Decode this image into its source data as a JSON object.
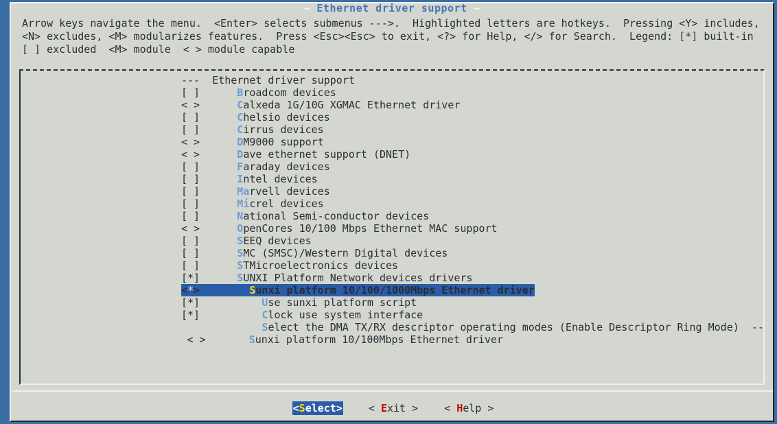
{
  "window": {
    "background_color": "#3b6ea5",
    "panel_color": "#d4d7d0",
    "title": "Ethernet driver support",
    "title_color": "#4876b8",
    "selection_bg": "#2b5ca8",
    "selection_fg": "#ffffff",
    "hotkey_color": "#6c9bd2",
    "hotkey_selected_color": "#ffe000",
    "button_hotkey_color": "#c00000",
    "title_dash_left": "—",
    "title_dash_right": "—"
  },
  "legend": {
    "text": "Arrow keys navigate the menu.  <Enter> selects submenus --->.  Highlighted letters are hotkeys.  Pressing <Y> includes,\n<N> excludes, <M> modularizes features.  Press <Esc><Esc> to exit, <?> for Help, </> for Search.  Legend: [*] built-in\n[ ] excluded  <M> module  < > module capable"
  },
  "menu": {
    "header": {
      "prefix": "---",
      "title": "Ethernet driver support"
    },
    "items": [
      {
        "marker": "[ ]",
        "hotkey": "B",
        "label": "roadcom devices",
        "indent": 0,
        "sub": 0,
        "selected": false,
        "submenu": false
      },
      {
        "marker": "< >",
        "hotkey": "C",
        "label": "alxeda 1G/10G XGMAC Ethernet driver",
        "indent": 0,
        "sub": 0,
        "selected": false,
        "submenu": false
      },
      {
        "marker": "[ ]",
        "hotkey": "C",
        "label": "helsio devices",
        "indent": 0,
        "sub": 0,
        "selected": false,
        "submenu": false
      },
      {
        "marker": "[ ]",
        "hotkey": "C",
        "label": "irrus devices",
        "indent": 0,
        "sub": 0,
        "selected": false,
        "submenu": false
      },
      {
        "marker": "< >",
        "hotkey": "D",
        "label": "M9000 support",
        "indent": 0,
        "sub": 0,
        "selected": false,
        "submenu": false
      },
      {
        "marker": "< >",
        "hotkey": "D",
        "label": "ave ethernet support (DNET)",
        "indent": 0,
        "sub": 0,
        "selected": false,
        "submenu": false
      },
      {
        "marker": "[ ]",
        "hotkey": "F",
        "label": "araday devices",
        "indent": 0,
        "sub": 0,
        "selected": false,
        "submenu": false
      },
      {
        "marker": "[ ]",
        "hotkey": "I",
        "label": "ntel devices",
        "indent": 0,
        "sub": 0,
        "selected": false,
        "submenu": false
      },
      {
        "marker": "[ ]",
        "hotkey": "Ma",
        "label": "rvell devices",
        "indent": 0,
        "sub": 0,
        "selected": false,
        "submenu": false
      },
      {
        "marker": "[ ]",
        "hotkey": "Mi",
        "label": "crel devices",
        "indent": 0,
        "sub": 0,
        "selected": false,
        "submenu": false
      },
      {
        "marker": "[ ]",
        "hotkey": "N",
        "label": "ational Semi-conductor devices",
        "indent": 0,
        "sub": 0,
        "selected": false,
        "submenu": false
      },
      {
        "marker": "< >",
        "hotkey": "O",
        "label": "penCores 10/100 Mbps Ethernet MAC support",
        "indent": 0,
        "sub": 0,
        "selected": false,
        "submenu": false
      },
      {
        "marker": "[ ]",
        "hotkey": "S",
        "label": "EEQ devices",
        "indent": 0,
        "sub": 0,
        "selected": false,
        "submenu": false
      },
      {
        "marker": "[ ]",
        "hotkey": "S",
        "label": "MC (SMSC)/Western Digital devices",
        "indent": 0,
        "sub": 0,
        "selected": false,
        "submenu": false
      },
      {
        "marker": "[ ]",
        "hotkey": "S",
        "label": "TMicroelectronics devices",
        "indent": 0,
        "sub": 0,
        "selected": false,
        "submenu": false
      },
      {
        "marker": "[*]",
        "hotkey": "S",
        "label": "UNXI Platform Network devices drivers",
        "indent": 0,
        "sub": 0,
        "selected": false,
        "submenu": false
      },
      {
        "marker": "<*>",
        "hotkey": "S",
        "label": "unxi platform 10/100/1000Mbps Ethernet driver",
        "indent": 0,
        "sub": 1,
        "selected": true,
        "submenu": false
      },
      {
        "marker": "[*]",
        "hotkey": "U",
        "label": "se sunxi platform script",
        "indent": 0,
        "sub": 2,
        "selected": false,
        "submenu": false
      },
      {
        "marker": "[*]",
        "hotkey": "C",
        "label": "lock use system interface",
        "indent": 0,
        "sub": 2,
        "selected": false,
        "submenu": false
      },
      {
        "marker": "   ",
        "hotkey": "S",
        "label": "elect the DMA TX/RX descriptor operating modes (Enable Descriptor Ring Mode)  --->",
        "indent": 0,
        "sub": 2,
        "selected": false,
        "submenu": true
      },
      {
        "marker": "< >",
        "hotkey": "S",
        "label": "unxi platform 10/100Mbps Ethernet driver",
        "indent": 1,
        "sub": 1,
        "selected": false,
        "submenu": false
      }
    ]
  },
  "buttons": [
    {
      "name": "select",
      "open": "<",
      "close": ">",
      "hotkey": "S",
      "rest": "elect",
      "active": true
    },
    {
      "name": "exit",
      "open": "< ",
      "close": " >",
      "hotkey": "E",
      "rest": "xit",
      "active": false
    },
    {
      "name": "help",
      "open": "< ",
      "close": " >",
      "hotkey": "H",
      "rest": "elp",
      "active": false
    }
  ]
}
